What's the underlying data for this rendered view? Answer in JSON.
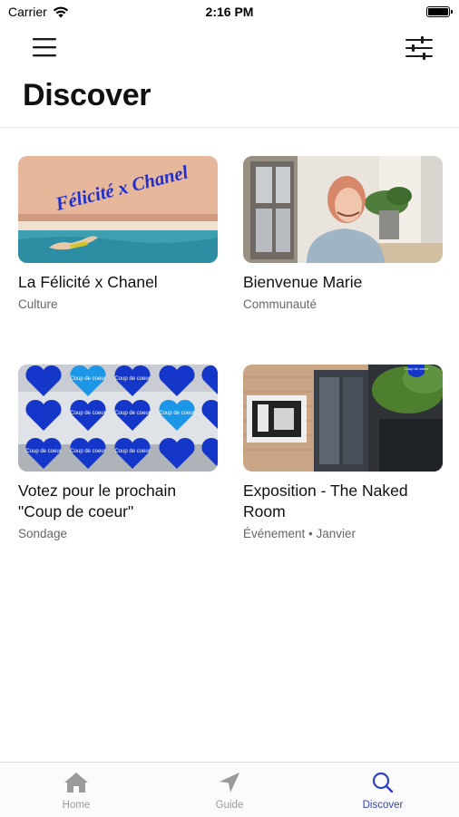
{
  "status_bar": {
    "carrier": "Carrier",
    "time": "2:16 PM"
  },
  "nav": {
    "menu_icon": "hamburger-menu-icon",
    "filter_icon": "sliders-filter-icon"
  },
  "page": {
    "title": "Discover"
  },
  "cards": [
    {
      "title": "La Félicité x Chanel",
      "meta": "Culture",
      "image_text": "Félicité x Chanel"
    },
    {
      "title": "Bienvenue Marie",
      "meta": "Communauté"
    },
    {
      "title": "Votez pour le prochain \"Coup de coeur\"",
      "meta": "Sondage",
      "image_text": "Coup de coeur"
    },
    {
      "title": "Exposition - The Naked Room",
      "meta": "Événement • Janvier",
      "image_text": "Coup de coeur"
    }
  ],
  "tabs": [
    {
      "label": "Home",
      "icon": "home-icon",
      "active": false
    },
    {
      "label": "Guide",
      "icon": "navigation-arrow-icon",
      "active": false
    },
    {
      "label": "Discover",
      "icon": "search-icon",
      "active": true
    }
  ],
  "colors": {
    "accent": "#2f3fc4",
    "inactive": "#9a9a9a",
    "heart_blue": "#1537c9"
  }
}
